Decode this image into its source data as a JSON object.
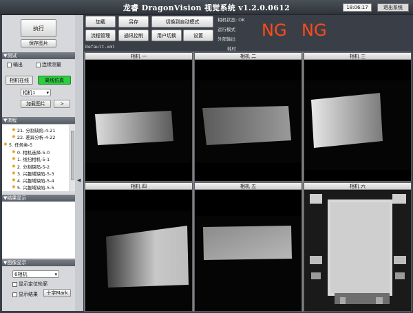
{
  "app": {
    "title": "龙睿 DragonVision 视觉系统 v1.2.0.0612",
    "clock": "18:06:17",
    "exit_label": "退出系统"
  },
  "left_top": {
    "run_label": "执行",
    "save_image_label": "保存图片"
  },
  "toolbar": {
    "load": "加载",
    "save_as": "另存",
    "switch_auto": "切换到自动模式",
    "flow_manage": "流程管理",
    "comm_control": "通讯控制",
    "user_switch": "用户切换",
    "settings": "设置",
    "file_name": "Default.xml"
  },
  "status": {
    "camera_state": "相机状态: OK",
    "run_mode": "运行模式",
    "external_output": "外部输出",
    "elapsed": "耗时",
    "ng_1": "NG",
    "ng_2": "NG"
  },
  "test_section": {
    "header": "▼测试",
    "output_label": "输出",
    "continuous_label": "连续测量",
    "camera_online": "相机在线",
    "offline_sim": "离线仿真",
    "camera_select": "相机1",
    "load_image": "加载图片",
    "next": ">"
  },
  "flow_section": {
    "header": "▼流程",
    "items": [
      {
        "text": "21. 分割缺陷-4-21",
        "indent": 1
      },
      {
        "text": "22. 差异分析-4-22",
        "indent": 1
      },
      {
        "text": "5. 任务类-5",
        "indent": 0
      },
      {
        "text": "0. 相机选择-5-0",
        "indent": 1
      },
      {
        "text": "1. 线扫相机-5-1",
        "indent": 1
      },
      {
        "text": "2. 分割缺陷-5-2",
        "indent": 1
      },
      {
        "text": "3. 兴趣域缺陷-5-3",
        "indent": 1
      },
      {
        "text": "4. 兴趣域缺陷-5-4",
        "indent": 1
      },
      {
        "text": "5. 兴趣域缺陷-5-5",
        "indent": 1
      }
    ]
  },
  "result_section": {
    "header": "▼结果显示"
  },
  "image_section": {
    "header": "▼图像显示",
    "camera_select": "6相机",
    "show_contour": "显示定位轮廓",
    "show_result": "显示结果",
    "crosshair": "十字Mark"
  },
  "cameras": [
    {
      "label": "相机 一"
    },
    {
      "label": "相机 二"
    },
    {
      "label": "相机 三"
    },
    {
      "label": "相机 四"
    },
    {
      "label": "相机 五"
    },
    {
      "label": "相机 六"
    }
  ]
}
